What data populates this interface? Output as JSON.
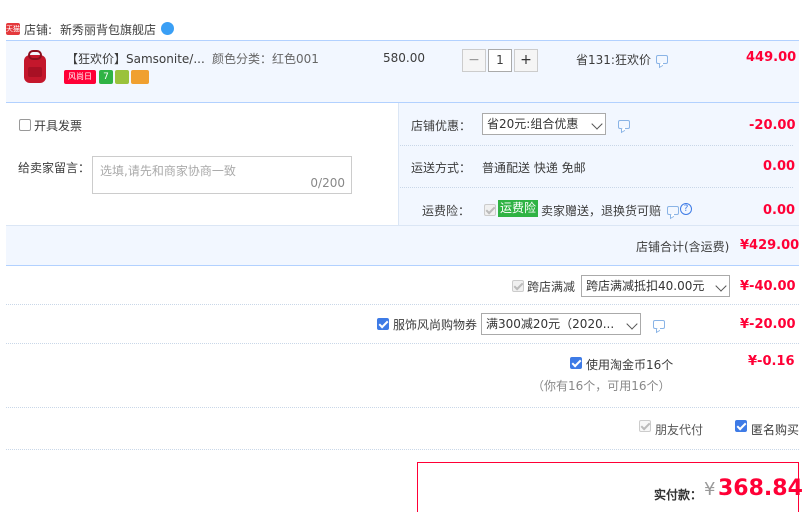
{
  "shop": {
    "badge": "tmall",
    "label": "店铺:",
    "name": "新秀丽背包旗舰店"
  },
  "item": {
    "title": "【狂欢价】Samsonite/...",
    "sku": "颜色分类：红色001",
    "orig_price": "580.00",
    "qty": "1",
    "promo": "省131:狂欢价",
    "subtotal": "449.00",
    "tags": [
      "风尚日",
      "7",
      "R",
      "card"
    ]
  },
  "invoice": {
    "label": "开具发票"
  },
  "message": {
    "label": "给卖家留言：",
    "placeholder": "选填,请先和商家协商一致",
    "count": "0/200"
  },
  "store_discount": {
    "label": "店铺优惠：",
    "selected": "省20元:组合优惠",
    "amount": "-20.00"
  },
  "shipping": {
    "label": "运送方式：",
    "value": "普通配送 快递 免邮",
    "amount": "0.00"
  },
  "insurance": {
    "label": "运费险：",
    "tag": "运费险",
    "value": "卖家赠送，退换货可赔",
    "amount": "0.00"
  },
  "shop_total": {
    "label": "店铺合计(含运费)",
    "amount": "¥429.00"
  },
  "cross_store": {
    "label": "跨店满减",
    "selected": "跨店满减抵扣40.00元",
    "amount": "¥-40.00"
  },
  "coupon": {
    "label": "服饰风尚购物券",
    "selected": "满300减20元（2020...",
    "amount": "¥-20.00"
  },
  "taojin": {
    "label": "使用淘金币16个",
    "note": "（你有16个，可用16个）",
    "amount": "¥-0.16"
  },
  "options": {
    "friend_pay": "朋友代付",
    "anonymous": "匿名购买"
  },
  "pay": {
    "label": "实付款：",
    "currency": "¥",
    "amount": "368.84"
  },
  "colors": {
    "accent_red": "#ff0036",
    "panel_blue": "#f2f7ff",
    "border_blue": "#b2d1ff",
    "check_blue": "#3e7be6"
  }
}
